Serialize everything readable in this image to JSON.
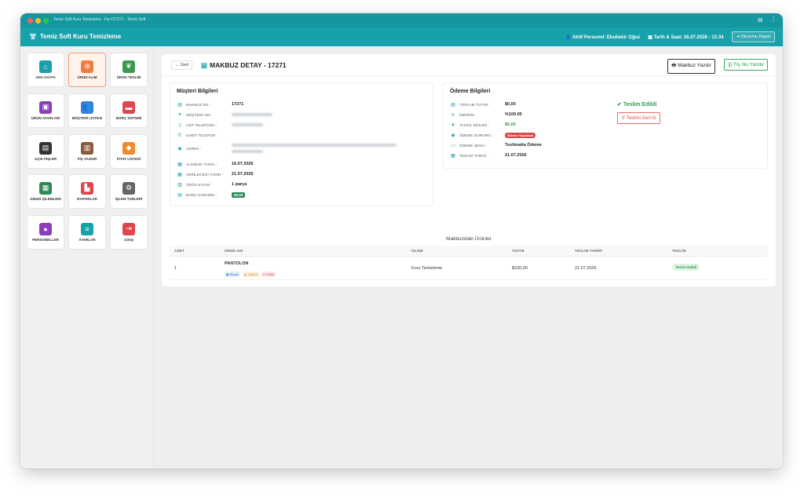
{
  "window": {
    "title": "Temiz Soft Kuru Temizleme - Fiş #17271 - Temiz Soft"
  },
  "header": {
    "brand": "Temiz Soft Kuru Temizleme",
    "active_staff": "Aktif Personel: Ebubekir Oğuz",
    "datetime": "Tarih & Saat: 26.07.2026 - 13:34",
    "logout": "Oturumu Kapat"
  },
  "sidebar": {
    "items": [
      {
        "label": "ANA SAYFA",
        "icon": "home-icon",
        "color": "#17a1aa"
      },
      {
        "label": "ÜRÜN ALIM",
        "icon": "plus-circle-icon",
        "color": "#f07c3e"
      },
      {
        "label": "ÜRÜN TESLİM",
        "icon": "leaf-icon",
        "color": "#3a9a4e"
      },
      {
        "label": "ÜRÜN AYARLARI",
        "icon": "box-icon",
        "color": "#8a3fb8"
      },
      {
        "label": "MÜŞTERİ LİSTESİ",
        "icon": "users-icon",
        "color": "#3b7dd8"
      },
      {
        "label": "BORÇ SİSTEMİ",
        "icon": "wallet-icon",
        "color": "#e0454e"
      },
      {
        "label": "AÇIK FİŞLER",
        "icon": "file-icon",
        "color": "#333333"
      },
      {
        "label": "FİŞ YAZDIR",
        "icon": "barcode-icon",
        "color": "#8a5a3c"
      },
      {
        "label": "FİYAT LİSTESİ",
        "icon": "tag-icon",
        "color": "#f08a2e"
      },
      {
        "label": "GİDER İŞLEMLERİ",
        "icon": "receipt-icon",
        "color": "#2e8b57"
      },
      {
        "label": "RAPORLAR",
        "icon": "chart-icon",
        "color": "#e0454e"
      },
      {
        "label": "İŞLEM TÜRLERİ",
        "icon": "gears-icon",
        "color": "#666666"
      },
      {
        "label": "PERSONELLER",
        "icon": "person-icon",
        "color": "#8a3fb8"
      },
      {
        "label": "AYARLAR",
        "icon": "sliders-icon",
        "color": "#17a1aa"
      },
      {
        "label": "ÇIKIŞ",
        "icon": "exit-icon",
        "color": "#e0454e"
      }
    ]
  },
  "page": {
    "back": "← Geri",
    "title": "MAKBUZ DETAY - 17271",
    "print_receipt": "Makbuz Yazdır",
    "print_slip": "Fiş No Yazdır"
  },
  "customer": {
    "title": "Müşteri Bilgileri",
    "rows": [
      {
        "label": "MAKBUZ NO :",
        "value": "17271"
      },
      {
        "label": "MÜŞTERİ ADI :",
        "value": ""
      },
      {
        "label": "CEP TELEFONU :",
        "value": ""
      },
      {
        "label": "SABİT TELEFON :",
        "value": ""
      },
      {
        "label": "ADRES :",
        "value": ""
      },
      {
        "label": "ALINDIĞI TARİH :",
        "value": "16.07.2026"
      },
      {
        "label": "VERİLECEĞİ TARİH :",
        "value": "21.07.2026"
      },
      {
        "label": "ÜRÜN SAYISI :",
        "value": "1 parça"
      },
      {
        "label": "BORÇ DURUMU :",
        "value": "$0,00"
      }
    ]
  },
  "payment": {
    "title": "Ödeme Bilgileri",
    "rows": [
      {
        "label": "TOPLAM TUTAR :",
        "value": "$0,00"
      },
      {
        "label": "İNDİRİM :",
        "value": "%100.00"
      },
      {
        "label": "TAHSİL EDİLEN :",
        "value": "$0,00"
      },
      {
        "label": "ÖDEME DURUMU :",
        "value": "Ödeme Yapılmadı"
      },
      {
        "label": "ÖDEME ŞEKLİ :",
        "value": "Teslimatta Ödeme"
      },
      {
        "label": "TESLİM TARİHİ :",
        "value": "21.07.2026"
      }
    ],
    "delivered": "Teslim Edildi",
    "undo": "Teslimi Geri Al"
  },
  "items": {
    "title": "Makbuzdaki Ürünler",
    "columns": [
      "ADET",
      "ÜRÜN ADI",
      "İŞLEM",
      "TUTAR",
      "TESLİM TARİHİ",
      "TESLİM"
    ],
    "rows": [
      {
        "qty": "1",
        "name": "PANTOLON",
        "tags": [
          "Beyaz",
          "Çamur",
          "Yırtık"
        ],
        "process": "Kuru Temizleme",
        "amount": "$230,00",
        "delivery_date": "21.07.2026",
        "status": "Teslim Edildi"
      }
    ]
  }
}
